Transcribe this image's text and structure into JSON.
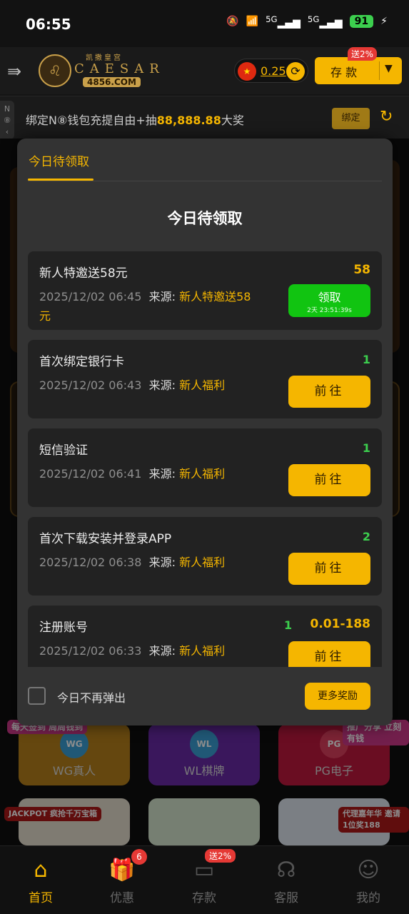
{
  "status": {
    "time": "06:55",
    "battery": "91",
    "net1": "5G",
    "net2": "5G"
  },
  "header": {
    "logo_sub": "凯撒皇宫",
    "logo_name": "CAESAR",
    "logo_domain": "4856.COM",
    "balance": "0.25",
    "deposit_label": "存 款",
    "deposit_badge": "送2%"
  },
  "marquee": {
    "text_pre": "绑定N⑧钱包充提自由+抽",
    "text_amount": "88,888.88",
    "text_post": "大奖",
    "bind_label": "绑定"
  },
  "background": {
    "cards": [
      {
        "label": "WG真人",
        "logo": "WG"
      },
      {
        "label": "WL棋牌",
        "logo": "WL"
      },
      {
        "label": "PG电子",
        "logo": "PG"
      }
    ],
    "promos": [
      "每天签到 周周钱到",
      "推广分享 立刻有钱",
      "JACKPOT 疯抢千万宝箱",
      "代理嘉年华 邀请1位奖188"
    ]
  },
  "modal": {
    "tab": "今日待领取",
    "title": "今日待领取",
    "source_label": "来源:",
    "tasks": [
      {
        "name": "新人特邀送58元",
        "time": "2025/12/02 06:45",
        "source": "新人特邀送58元",
        "count": "",
        "reward": "58",
        "button": "领取",
        "timer": "2天 23:51:39s"
      },
      {
        "name": "首次绑定银行卡",
        "time": "2025/12/02 06:43",
        "source": "新人福利",
        "count": "1",
        "reward": "",
        "button": "前往",
        "timer": ""
      },
      {
        "name": "短信验证",
        "time": "2025/12/02 06:41",
        "source": "新人福利",
        "count": "1",
        "reward": "",
        "button": "前往",
        "timer": ""
      },
      {
        "name": "首次下载安装并登录APP",
        "time": "2025/12/02 06:38",
        "source": "新人福利",
        "count": "2",
        "reward": "",
        "button": "前往",
        "timer": ""
      },
      {
        "name": "注册账号",
        "time": "2025/12/02 06:33",
        "source": "新人福利",
        "count": "1",
        "reward": "0.01-188",
        "button": "前往",
        "timer": ""
      }
    ],
    "checkbox_label": "今日不再弹出",
    "more_button": "更多奖励"
  },
  "nav": {
    "items": [
      {
        "label": "首页",
        "icon": "home-icon"
      },
      {
        "label": "优惠",
        "icon": "gift-icon",
        "badge": "6"
      },
      {
        "label": "存款",
        "icon": "wallet-icon",
        "badge": "送2%"
      },
      {
        "label": "客服",
        "icon": "headset-icon"
      },
      {
        "label": "我的",
        "icon": "user-icon"
      }
    ]
  },
  "colors": {
    "accent": "#f5b600",
    "success": "#3ccf4e",
    "claim": "#11c411",
    "modal_bg": "#333333",
    "card_bg": "#222222"
  }
}
